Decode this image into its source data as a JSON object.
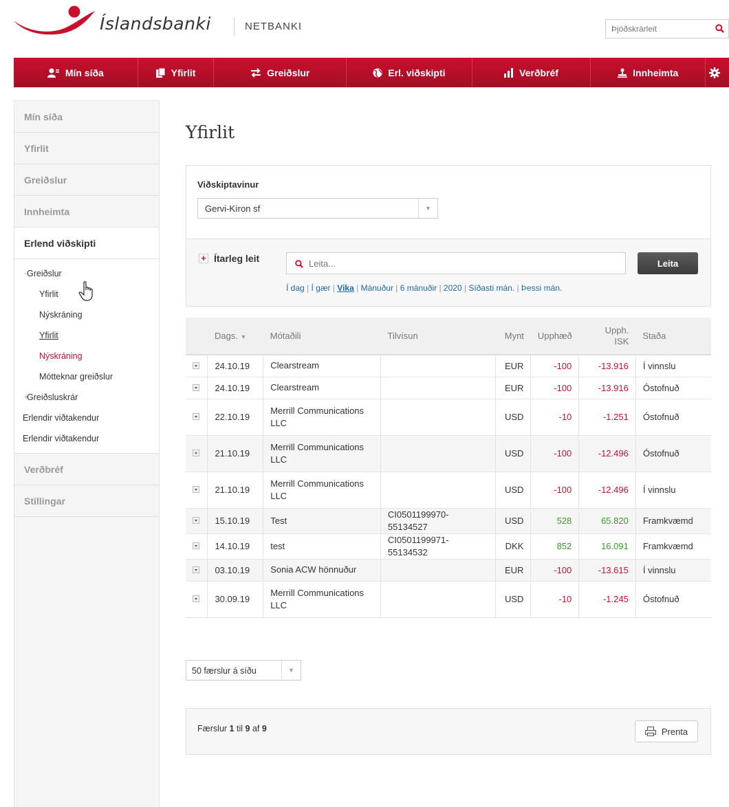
{
  "header": {
    "logo_text": "Íslandsbanki",
    "product": "NETBANKI",
    "natreg_placeholder": "Þjóðskrárleit"
  },
  "topnav": {
    "items": [
      {
        "label": "Mín síða",
        "icon": "user-icon"
      },
      {
        "label": "Yfirlit",
        "icon": "documents-icon"
      },
      {
        "label": "Greiðslur",
        "icon": "transfer-icon"
      },
      {
        "label": "Erl. viðskipti",
        "icon": "globe-icon"
      },
      {
        "label": "Verðbréf",
        "icon": "bar-chart-icon"
      },
      {
        "label": "Innheimta",
        "icon": "stamp-icon"
      }
    ],
    "settings_icon": "gear-icon"
  },
  "sidebar": {
    "items_top": [
      "Mín síða",
      "Yfirlit",
      "Greiðslur",
      "Innheimta"
    ],
    "active": "Erlend viðskipti",
    "sub": {
      "greidslur": "Greiðslur",
      "yfirlit1": "Yfirlit",
      "nyskraning1": "Nýskráning",
      "yfirlit2": "Yfirlit",
      "nyskraning2": "Nýskráning",
      "mottekar": "Mótteknar greiðslur",
      "greidsluskrar": "Greiðsluskrár",
      "erlendir1": "Erlendir viðtakendur",
      "erlendir2": "Erlendir viðtakendur"
    },
    "items_bottom": [
      "Verðbréf",
      "Stillingar"
    ]
  },
  "main": {
    "title": "Yfirlit",
    "customer_label": "Viðskiptavinur",
    "customer_value": "Gervi-Kíron sf",
    "advanced_search": "Ítarleg leit",
    "search_placeholder": "Leita...",
    "search_button": "Leita",
    "quick_filters": [
      "Í dag",
      "Í gær",
      "Vika",
      "Mánuður",
      "6 mánuðir",
      "2020",
      "Síðasti mán.",
      "Þessi mán."
    ],
    "quick_selected": "Vika"
  },
  "table": {
    "headers": {
      "date": "Dags.",
      "payee": "Mótaðili",
      "reference": "Tilvísun",
      "currency": "Mynt",
      "amount": "Upphæð",
      "amount_isk_1": "Upph.",
      "amount_isk_2": "ISK",
      "status": "Staða"
    },
    "rows": [
      {
        "date": "24.10.19",
        "payee": "Clearstream",
        "ref": "",
        "cur": "EUR",
        "amount": "-100",
        "isk": "-13.916",
        "status": "Í vinnslu"
      },
      {
        "date": "24.10.19",
        "payee": "Clearstream",
        "ref": "",
        "cur": "EUR",
        "amount": "-100",
        "isk": "-13.916",
        "status": "Óstofnuð"
      },
      {
        "date": "22.10.19",
        "payee": "Merrill Communications LLC",
        "ref": "",
        "cur": "USD",
        "amount": "-10",
        "isk": "-1.251",
        "status": "Óstofnuð"
      },
      {
        "date": "21.10.19",
        "payee": "Merrill Communications LLC",
        "ref": "",
        "cur": "USD",
        "amount": "-100",
        "isk": "-12.496",
        "status": "Óstofnuð"
      },
      {
        "date": "21.10.19",
        "payee": "Merrill Communications LLC",
        "ref": "",
        "cur": "USD",
        "amount": "-100",
        "isk": "-12.496",
        "status": "Í vinnslu"
      },
      {
        "date": "15.10.19",
        "payee": "Test",
        "ref": "CI0501199970-55134527",
        "cur": "USD",
        "amount": "528",
        "isk": "65.820",
        "status": "Framkvæmd"
      },
      {
        "date": "14.10.19",
        "payee": "test",
        "ref": "CI0501199971-55134532",
        "cur": "DKK",
        "amount": "852",
        "isk": "16.091",
        "status": "Framkvæmd"
      },
      {
        "date": "03.10.19",
        "payee": "Sonia ACW hönnuður",
        "ref": "",
        "cur": "EUR",
        "amount": "-100",
        "isk": "-13.615",
        "status": "Í vinnslu"
      },
      {
        "date": "30.09.19",
        "payee": "Merrill Communications LLC",
        "ref": "",
        "cur": "USD",
        "amount": "-10",
        "isk": "-1.245",
        "status": "Óstofnuð"
      }
    ]
  },
  "footer": {
    "per_page": "50 færslur á síðu",
    "count_prefix": "Færslur",
    "count_from": "1",
    "count_mid": "til",
    "count_to": "9",
    "count_of": "af",
    "count_total": "9",
    "print_button": "Prenta"
  },
  "colors": {
    "brand_red": "#c8102e",
    "negative": "#c8102e",
    "positive": "#3a9a2a",
    "link": "#1f6aa5"
  }
}
